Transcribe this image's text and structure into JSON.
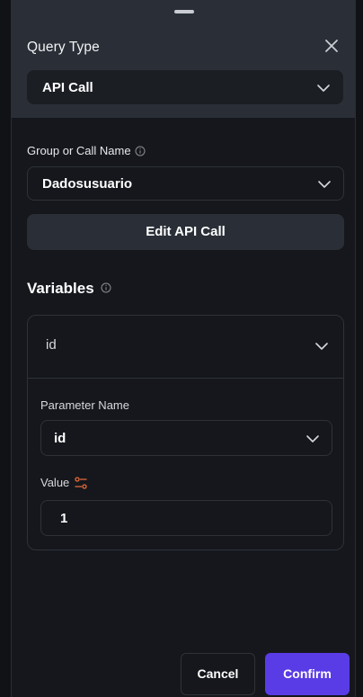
{
  "header": {
    "title": "Query Type"
  },
  "query_type": {
    "selected": "API Call"
  },
  "group": {
    "label": "Group or Call Name",
    "selected": "Dadosusuario"
  },
  "edit_button": {
    "label": "Edit API Call"
  },
  "variables": {
    "title": "Variables",
    "items": [
      {
        "name": "id",
        "parameter_label": "Parameter Name",
        "parameter_value": "id",
        "value_label": "Value",
        "value": "1"
      }
    ]
  },
  "footer": {
    "cancel_label": "Cancel",
    "confirm_label": "Confirm"
  },
  "colors": {
    "accent": "#5a3ce6",
    "value_icon": "#e86b3a"
  },
  "icons": {
    "close": "close-icon",
    "chevron": "chevron-down-icon",
    "info": "info-icon",
    "value_source": "tune-icon"
  }
}
